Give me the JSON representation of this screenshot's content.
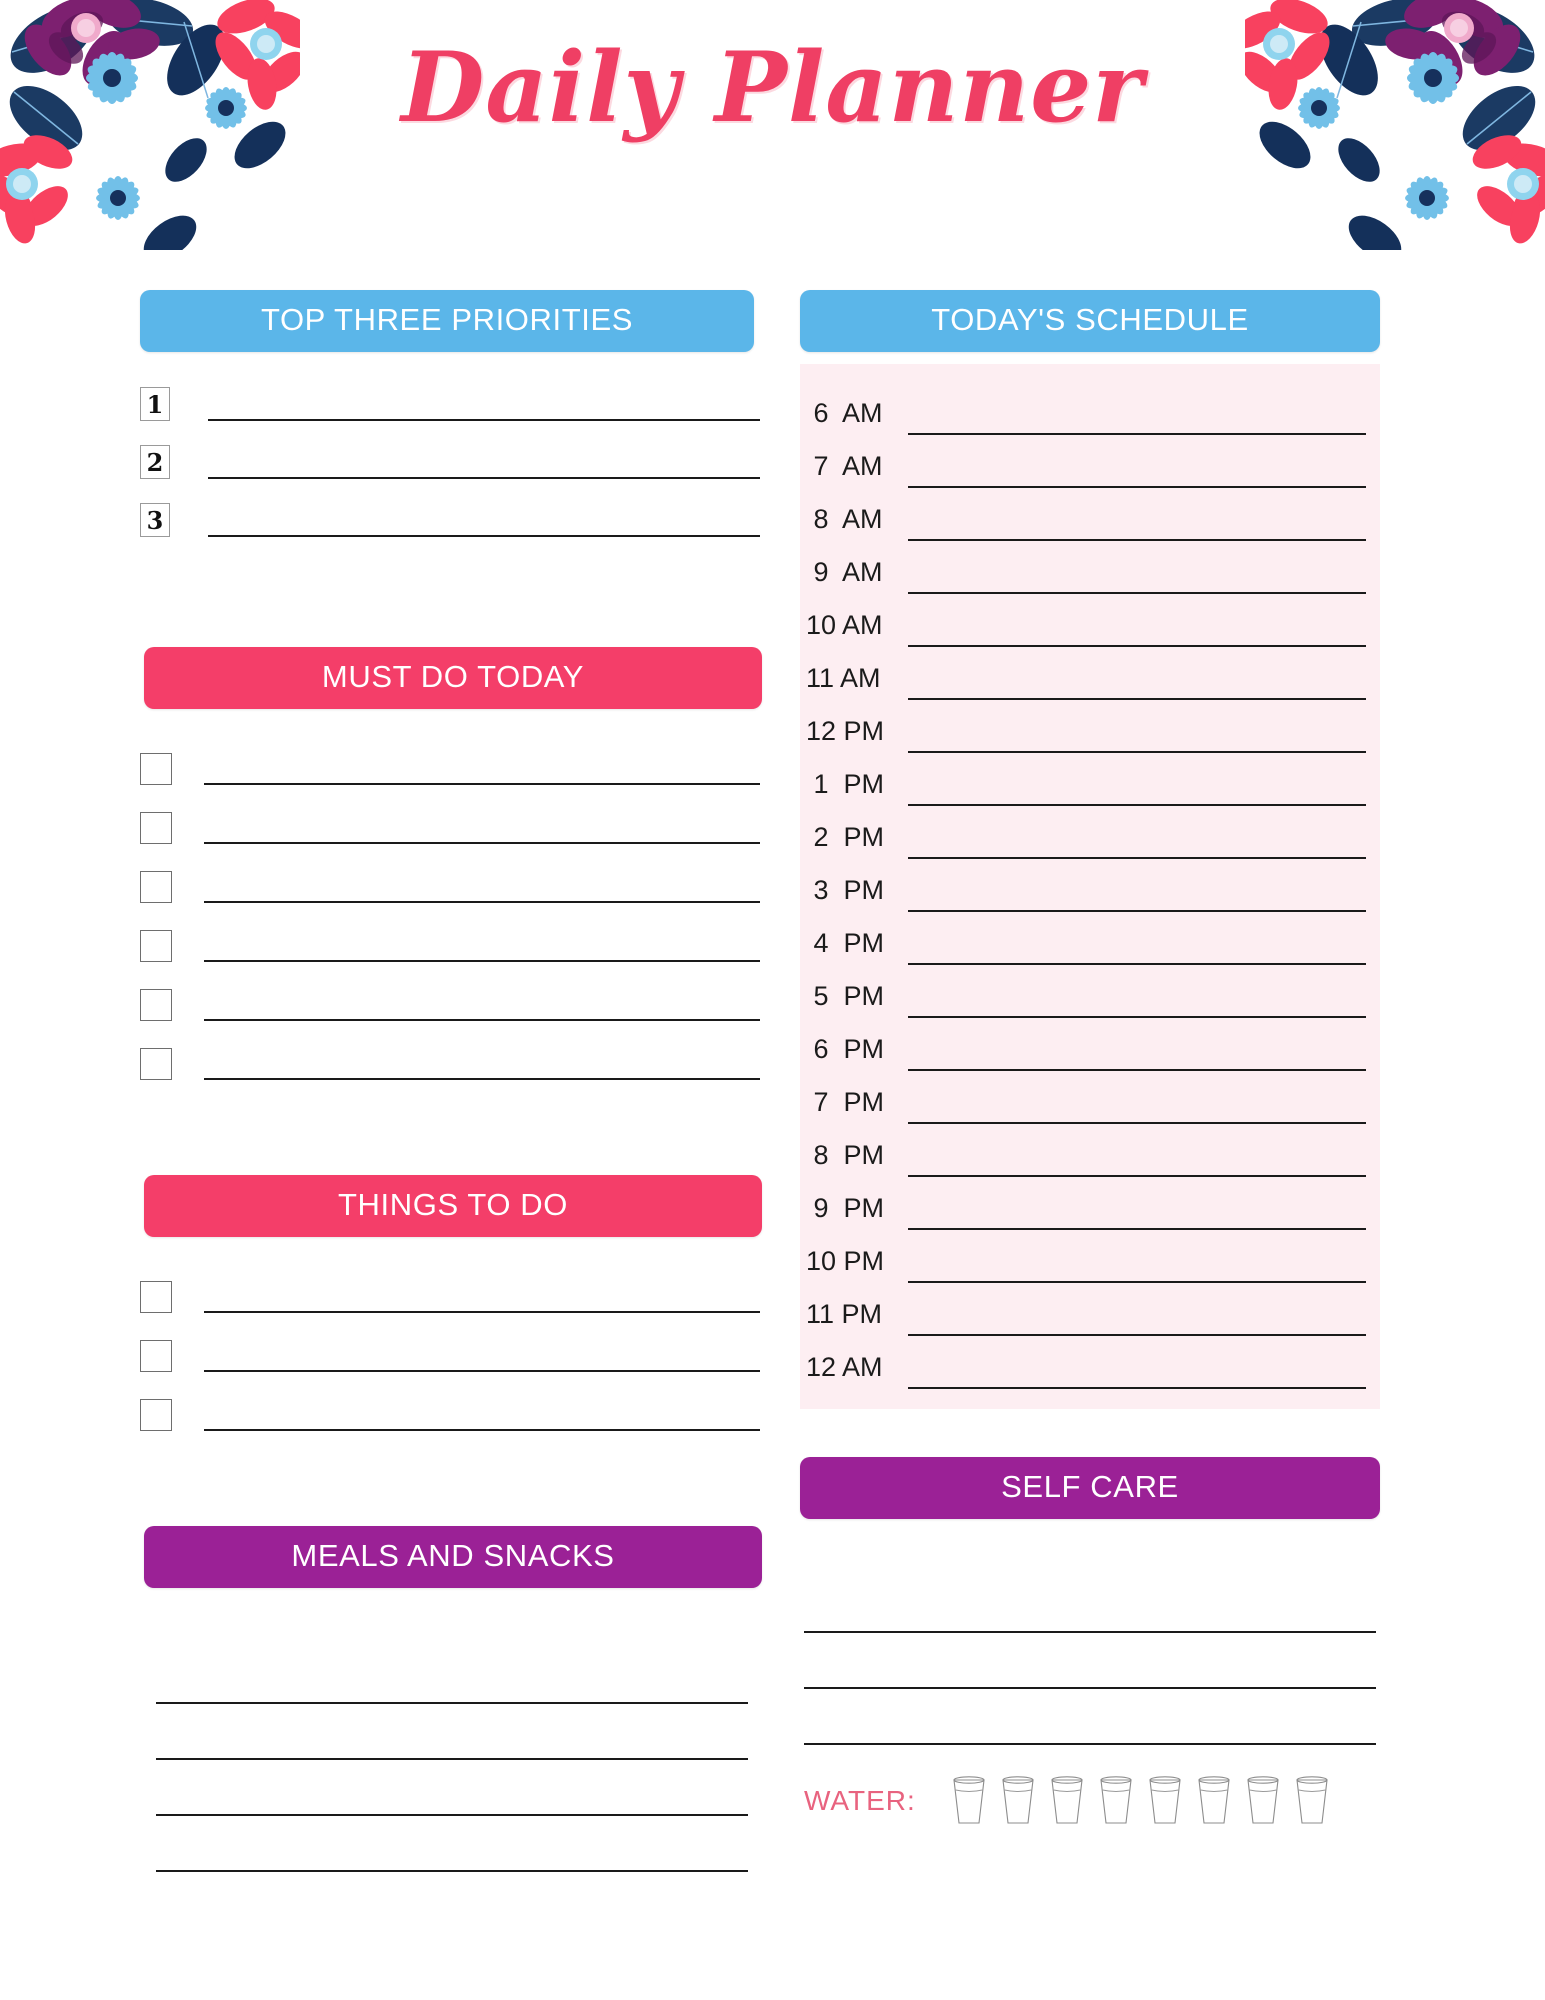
{
  "title": "Daily Planner",
  "colors": {
    "blue": "#5bb6e9",
    "pink": "#f43e69",
    "purple": "#9b2196",
    "title_pink": "#ef3f64",
    "schedule_bg": "#fdeef2",
    "water_label": "#e8637f"
  },
  "sections": {
    "priorities": {
      "heading": "TOP THREE PRIORITIES",
      "items": [
        {
          "number": "1",
          "value": ""
        },
        {
          "number": "2",
          "value": ""
        },
        {
          "number": "3",
          "value": ""
        }
      ]
    },
    "must_do": {
      "heading": "MUST DO TODAY",
      "items": [
        {
          "checked": false,
          "value": ""
        },
        {
          "checked": false,
          "value": ""
        },
        {
          "checked": false,
          "value": ""
        },
        {
          "checked": false,
          "value": ""
        },
        {
          "checked": false,
          "value": ""
        },
        {
          "checked": false,
          "value": ""
        }
      ]
    },
    "things_to_do": {
      "heading": "THINGS TO DO",
      "items": [
        {
          "checked": false,
          "value": ""
        },
        {
          "checked": false,
          "value": ""
        },
        {
          "checked": false,
          "value": ""
        }
      ]
    },
    "meals": {
      "heading": "MEALS AND SNACKS",
      "lines": [
        "",
        "",
        "",
        ""
      ]
    },
    "schedule": {
      "heading": "TODAY'S SCHEDULE",
      "rows": [
        {
          "hour": "6",
          "period": "AM",
          "value": ""
        },
        {
          "hour": "7",
          "period": "AM",
          "value": ""
        },
        {
          "hour": "8",
          "period": "AM",
          "value": ""
        },
        {
          "hour": "9",
          "period": "AM",
          "value": ""
        },
        {
          "hour": "10",
          "period": "AM",
          "value": ""
        },
        {
          "hour": "11",
          "period": "AM",
          "value": ""
        },
        {
          "hour": "12",
          "period": "PM",
          "value": ""
        },
        {
          "hour": "1",
          "period": "PM",
          "value": ""
        },
        {
          "hour": "2",
          "period": "PM",
          "value": ""
        },
        {
          "hour": "3",
          "period": "PM",
          "value": ""
        },
        {
          "hour": "4",
          "period": "PM",
          "value": ""
        },
        {
          "hour": "5",
          "period": "PM",
          "value": ""
        },
        {
          "hour": "6",
          "period": "PM",
          "value": ""
        },
        {
          "hour": "7",
          "period": "PM",
          "value": ""
        },
        {
          "hour": "8",
          "period": "PM",
          "value": ""
        },
        {
          "hour": "9",
          "period": "PM",
          "value": ""
        },
        {
          "hour": "10",
          "period": "PM",
          "value": ""
        },
        {
          "hour": "11",
          "period": "PM",
          "value": ""
        },
        {
          "hour": "12",
          "period": "AM",
          "value": ""
        }
      ]
    },
    "self_care": {
      "heading": "SELF CARE",
      "lines": [
        "",
        "",
        ""
      ],
      "water": {
        "label": "WATER:",
        "glass_count": 8,
        "glasses_filled": 0
      }
    }
  },
  "decorations": {
    "corner_floral_left": "floral-corner-icon",
    "corner_floral_right": "floral-corner-icon"
  }
}
